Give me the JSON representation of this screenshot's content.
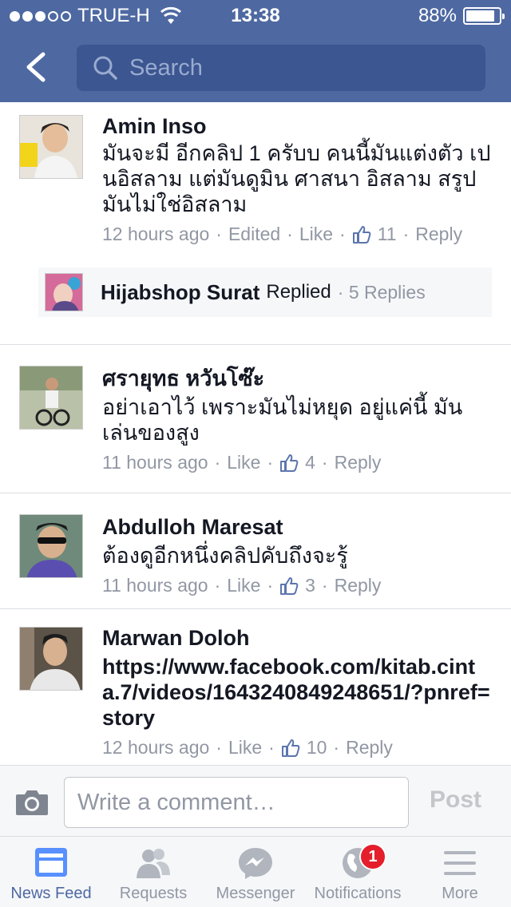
{
  "status_bar": {
    "carrier": "TRUE-H",
    "time": "13:38",
    "battery": "88%",
    "battery_level": 0.88
  },
  "nav": {
    "search_placeholder": "Search"
  },
  "comments": [
    {
      "name": "Amin Inso",
      "text": "มันจะมี อีกคลิป 1 ครับบ คนนี้มันแต่งตัว เปนอิสลาม แต่มันดูมิน ศาสนา อิสลาม สรูปมันไม่ใช่อิสลาม",
      "time": "12 hours ago",
      "edited": "Edited",
      "like": "Like",
      "likes": "11",
      "reply": "Reply",
      "reply_summary": {
        "name": "Hijabshop Surat",
        "verb": "Replied",
        "count": "5 Replies"
      }
    },
    {
      "name": "ศรายุทธ หวันโซ๊ะ",
      "text": "อย่าเอาไว้ เพราะมันไม่หยุด อยู่แค่นี้ มันเล่นของสูง",
      "time": "11 hours ago",
      "like": "Like",
      "likes": "4",
      "reply": "Reply"
    },
    {
      "name": "Abdulloh Maresat",
      "text": "ต้องดูอีกหนึ่งคลิปคับถึงจะรู้",
      "time": "11 hours ago",
      "like": "Like",
      "likes": "3",
      "reply": "Reply"
    },
    {
      "name": "Marwan Doloh",
      "text": "https://www.facebook.com/kitab.cinta.7/videos/1643240849248651/?pnref=story",
      "time": "12 hours ago",
      "like": "Like",
      "likes": "10",
      "reply": "Reply"
    }
  ],
  "composer": {
    "placeholder": "Write a comment…",
    "post_label": "Post"
  },
  "tabs": [
    {
      "label": "News Feed",
      "icon": "news-feed-icon",
      "active": true
    },
    {
      "label": "Requests",
      "icon": "friends-icon"
    },
    {
      "label": "Messenger",
      "icon": "messenger-icon"
    },
    {
      "label": "Notifications",
      "icon": "globe-icon",
      "badge": "1"
    },
    {
      "label": "More",
      "icon": "menu-icon"
    }
  ],
  "colors": {
    "brand": "#4e69a2",
    "badge": "#e41e2b",
    "meta": "#9197a3"
  }
}
